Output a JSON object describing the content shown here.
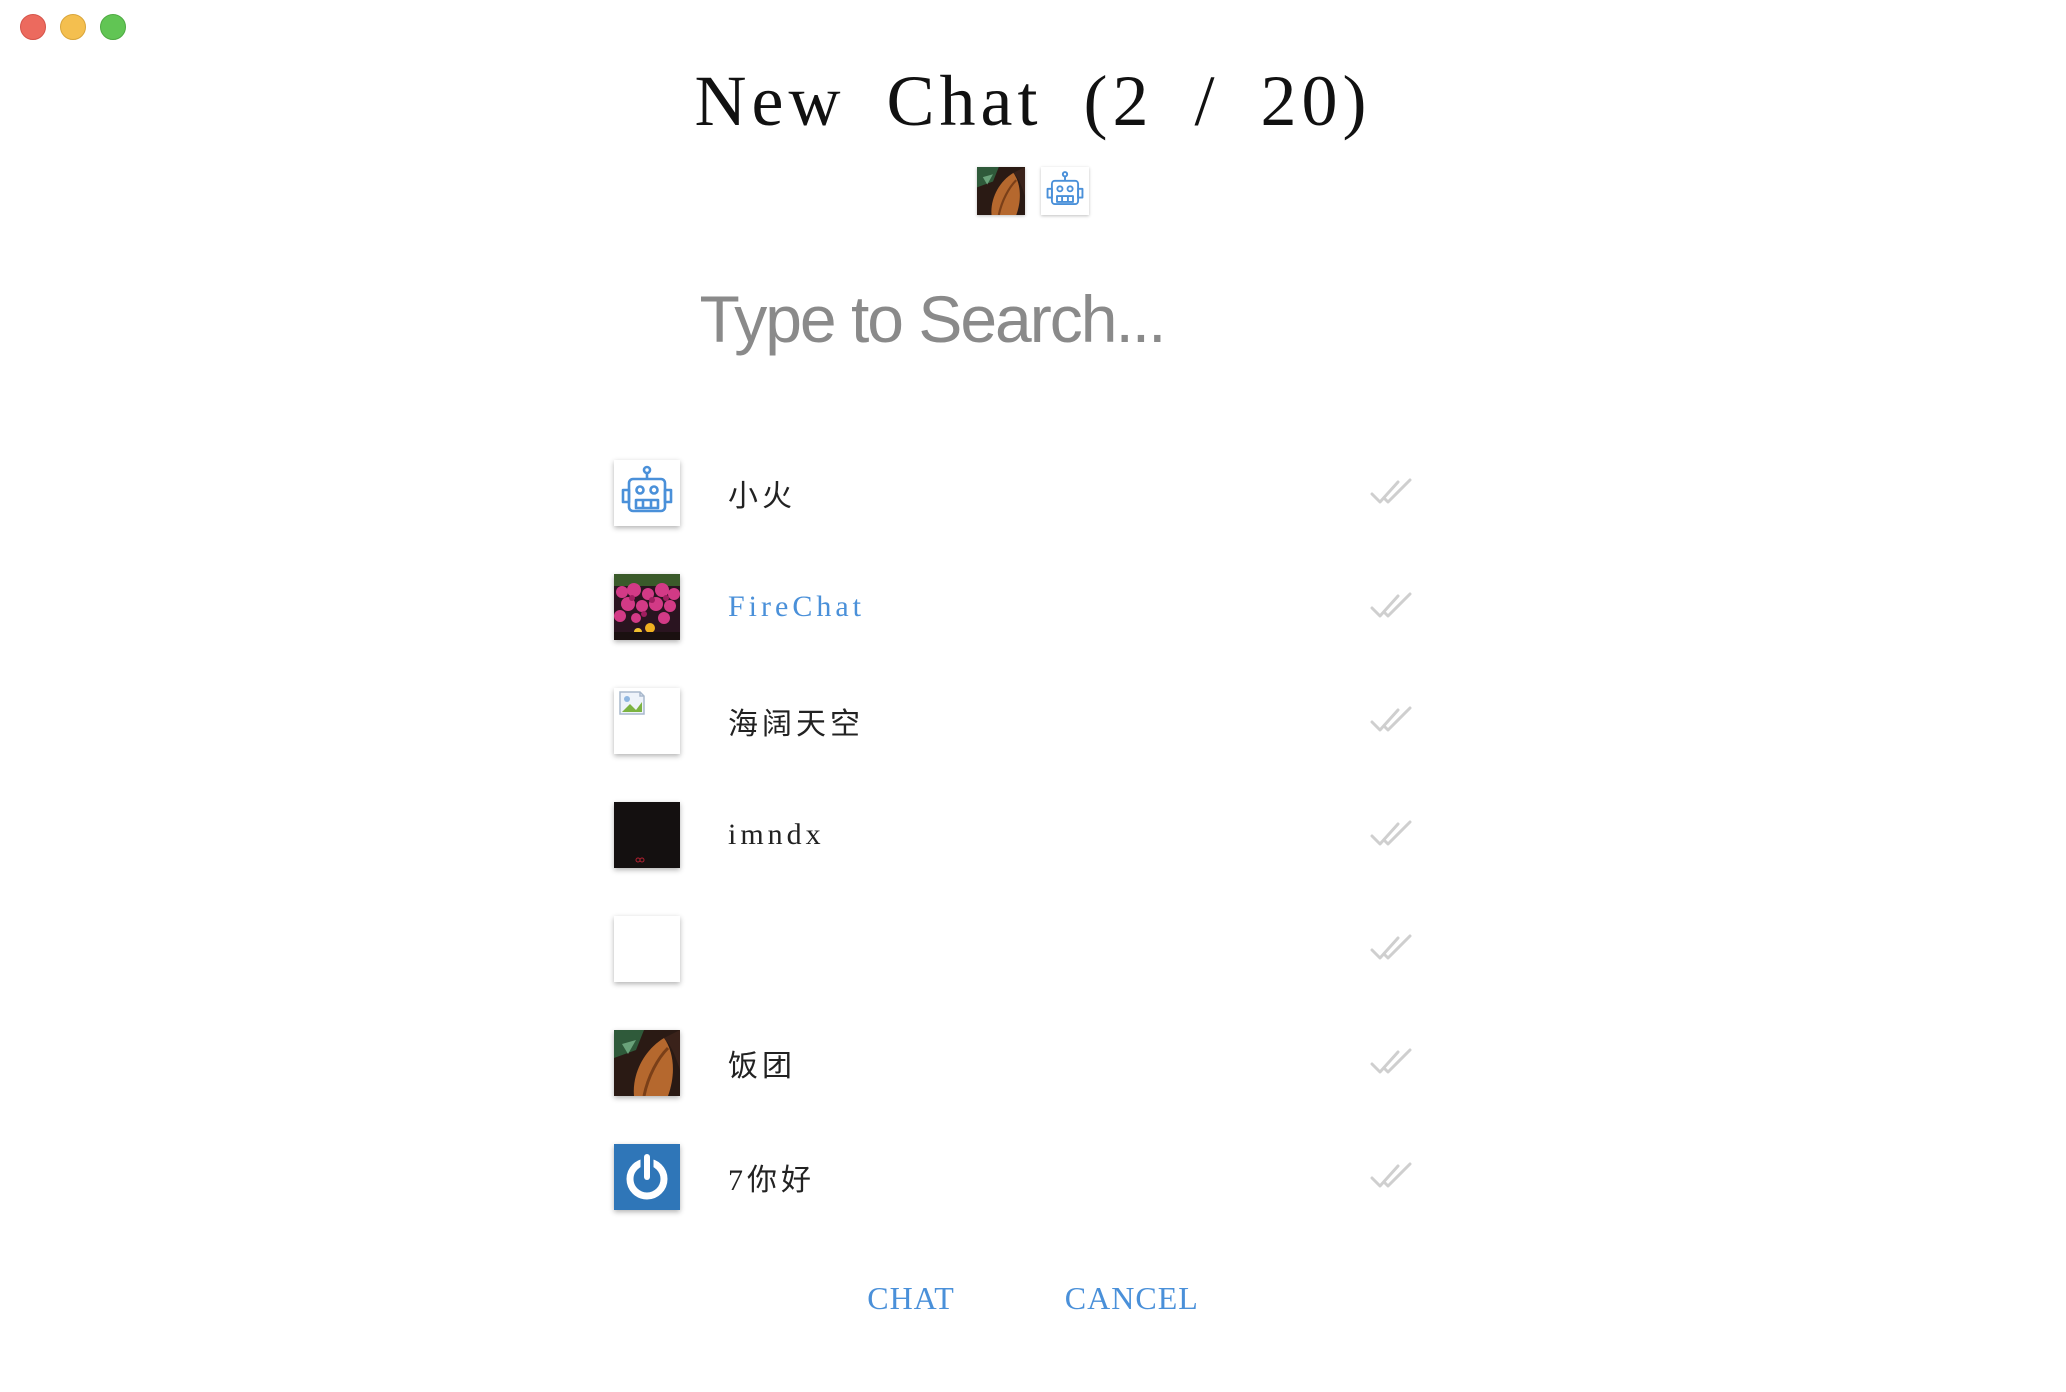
{
  "window": {
    "controls": [
      "close",
      "minimize",
      "maximize"
    ],
    "colors": {
      "close": "#ec6a5e",
      "minimize": "#f4bf4f",
      "maximize": "#61c554"
    }
  },
  "header": {
    "title": "New Chat (2 / 20)"
  },
  "selected": [
    {
      "avatar": "leaf-photo"
    },
    {
      "avatar": "robot-icon"
    }
  ],
  "search": {
    "placeholder": "Type to Search...",
    "value": ""
  },
  "contacts": [
    {
      "name": "小火",
      "avatar": "robot-icon",
      "highlighted": false
    },
    {
      "name": "FireChat",
      "avatar": "flowers-photo",
      "highlighted": true
    },
    {
      "name": "海阔天空",
      "avatar": "broken-image-icon",
      "highlighted": false
    },
    {
      "name": "imndx",
      "avatar": "dark-photo",
      "highlighted": false
    },
    {
      "name": "",
      "avatar": "blank",
      "highlighted": false
    },
    {
      "name": "饭团",
      "avatar": "leaf-photo",
      "highlighted": false
    },
    {
      "name": "7你好",
      "avatar": "power-icon",
      "highlighted": false
    }
  ],
  "actions": {
    "chat_label": "CHAT",
    "cancel_label": "CANCEL"
  },
  "colors": {
    "accent": "#4a90d9",
    "check": "#cfcfcf"
  }
}
